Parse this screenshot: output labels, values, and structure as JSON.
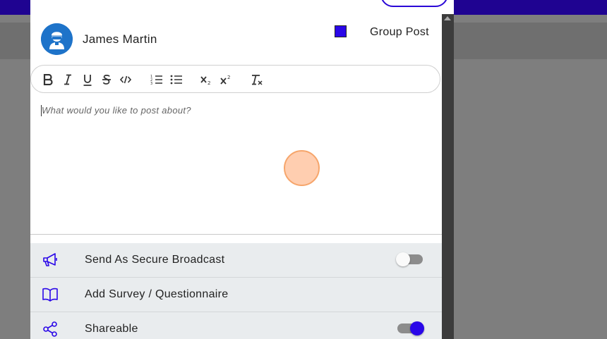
{
  "colors": {
    "accent": "#2a07e8",
    "topbar": "#1f0391",
    "click_marker": "#f6a56b"
  },
  "post": {
    "author_name": "James Martin",
    "group_post_label": "Group Post",
    "group_post_checked": true
  },
  "toolbar": {
    "buttons": [
      "bold-icon",
      "italic-icon",
      "underline-icon",
      "strikethrough-icon",
      "code-icon",
      "ordered-list-icon",
      "bullet-list-icon",
      "subscript-icon",
      "superscript-icon",
      "clear-format-icon"
    ]
  },
  "editor": {
    "placeholder": "What would you like to post about?"
  },
  "options": [
    {
      "label": "Send As Secure Broadcast",
      "icon": "megaphone-icon",
      "toggle": false
    },
    {
      "label": "Add Survey / Questionnaire",
      "icon": "book-icon"
    },
    {
      "label": "Shareable",
      "icon": "share-icon",
      "toggle": true
    }
  ]
}
